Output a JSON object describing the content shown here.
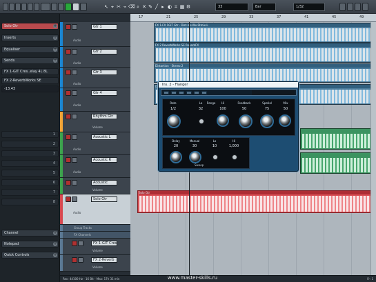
{
  "toolbar": {
    "time_display": "33",
    "mode_display": "Bar",
    "grid_display": "1/32"
  },
  "inspector": {
    "items": [
      {
        "label": "Solo Gtr",
        "state": "selected"
      },
      {
        "label": "Inserts",
        "state": "normal"
      },
      {
        "label": "Equaliser",
        "state": "normal"
      },
      {
        "label": "Sends",
        "state": "normal"
      },
      {
        "label": "Channel",
        "state": "normal"
      },
      {
        "label": "Notepad",
        "state": "normal"
      },
      {
        "label": "Quick Controls",
        "state": "normal"
      }
    ],
    "send_lines": [
      "FX 1-GIT Cres..elay 4L 8L",
      "FX 2-ReverbWorks SE",
      "-13.43"
    ],
    "numbers": [
      "1",
      "2",
      "3",
      "4",
      "5",
      "6",
      "7",
      "8"
    ]
  },
  "tracks": [
    {
      "name": "Gtr 1",
      "label": "Audio",
      "color": "#1a86d2"
    },
    {
      "name": "Gtr 2",
      "label": "Audio",
      "color": "#1a86d2"
    },
    {
      "name": "Gtr 3",
      "label": "Audio",
      "color": "#1a86d2"
    },
    {
      "name": "Gtr 4",
      "label": "Audio",
      "color": "#1a86d2"
    },
    {
      "name": "Rhythm Gtr",
      "label": "Volume",
      "color": "#f1a436"
    },
    {
      "name": "Acoustic L",
      "label": "Audio",
      "color": "#3ca34d"
    },
    {
      "name": "Acoustic R",
      "label": "Audio",
      "color": "#3ca34d"
    },
    {
      "name": "Acoustic",
      "label": "Volume",
      "color": "#3ca34d"
    },
    {
      "name": "Solo Gtr",
      "label": "Audio",
      "color": "#d7484f"
    },
    {
      "name": "Group Tracks",
      "label": "",
      "color": "#5b7994"
    },
    {
      "name": "FX Channels",
      "label": "",
      "color": "#5b7994"
    },
    {
      "name": "FX 1-GIT Cres",
      "label": "Volume",
      "color": "#5b7994"
    },
    {
      "name": "FX 2-Reverb",
      "label": "Volume",
      "color": "#5b7994"
    }
  ],
  "ruler": {
    "labels": [
      "17",
      "21",
      "25",
      "29",
      "33",
      "37",
      "41",
      "45",
      "49"
    ]
  },
  "events": [
    {
      "title": "FX 1-FX 1GIT Gtr - Dist-Ins-Wv-Stmix-L",
      "kind": "blue"
    },
    {
      "title": "FX 2 ReverbWorks SE ReverbFX",
      "kind": "blue"
    },
    {
      "title": "Distortion - Stereo 2",
      "kind": "blue"
    },
    {
      "title": "Distortion - Stereo 3",
      "kind": "blue"
    },
    {
      "title": "Solo Gtr",
      "kind": "red"
    }
  ],
  "plugin": {
    "title": "Ins. 2 - Flanger",
    "preset": "",
    "top_row_labels": [
      "Rate",
      "Lo",
      "Range",
      "Hi",
      "Feedback",
      "Spatial",
      "Mix"
    ],
    "top_row_values": [
      "1/2",
      "32",
      "100",
      "50",
      "75",
      "50",
      ""
    ],
    "bottom_labels": [
      "Delay",
      "Manual",
      "Lo",
      "Hi"
    ],
    "bottom_values": [
      "20",
      "30",
      "10",
      "1,000"
    ],
    "footer": "Sweep"
  },
  "status": {
    "record": "Rec: 44100 Hz - 16 Bit - Max: 17h 31 min",
    "watermark": "www.master-skills.ru",
    "page": "Fr: 1"
  }
}
